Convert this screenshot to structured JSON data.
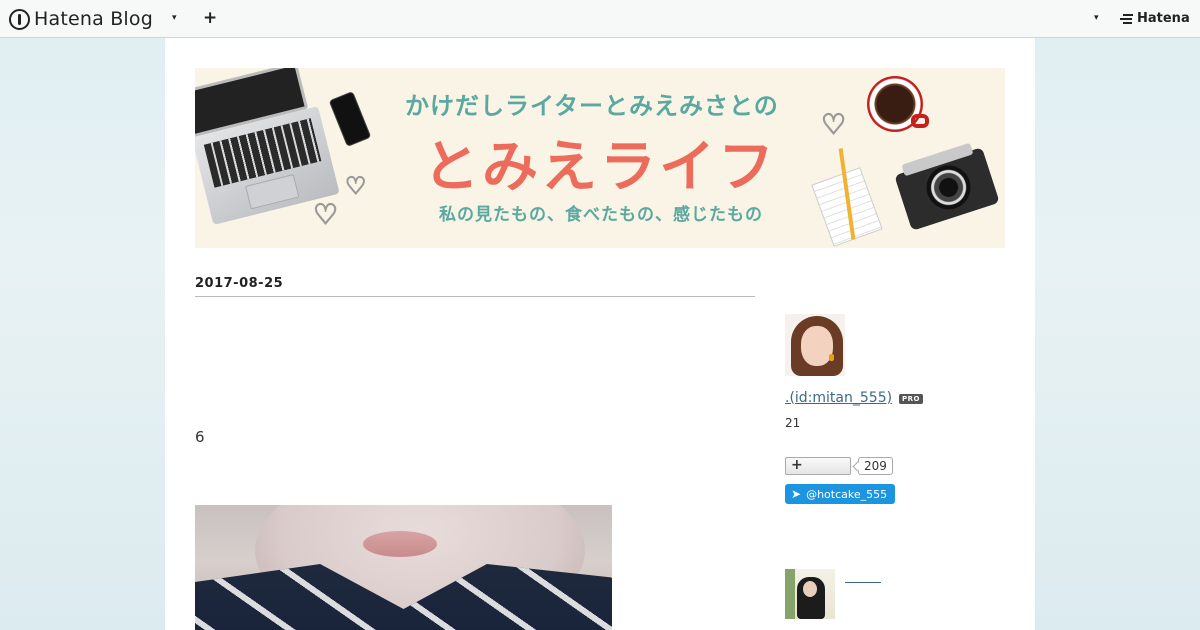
{
  "globalnav": {
    "logo_text": "Hatena Blog",
    "plus_label": "+",
    "hatena_text": "Hatena",
    "caret": "▾"
  },
  "header": {
    "banner_subtitle": "かけだしライターとみえみさとの",
    "banner_title": "とみえライフ",
    "banner_tagline": "私の見たもの、食べたもの、感じたもの"
  },
  "entry": {
    "date": "2017-08-25",
    "paragraph": "6"
  },
  "sidebar": {
    "author_link": ".(id:mitan_555)",
    "pro_badge": "PRO",
    "days": "21",
    "readers_plus": "+",
    "readers_count": "209",
    "twitter_handle": "@hotcake_555",
    "twitter_icon": "twitter-bird-icon"
  }
}
